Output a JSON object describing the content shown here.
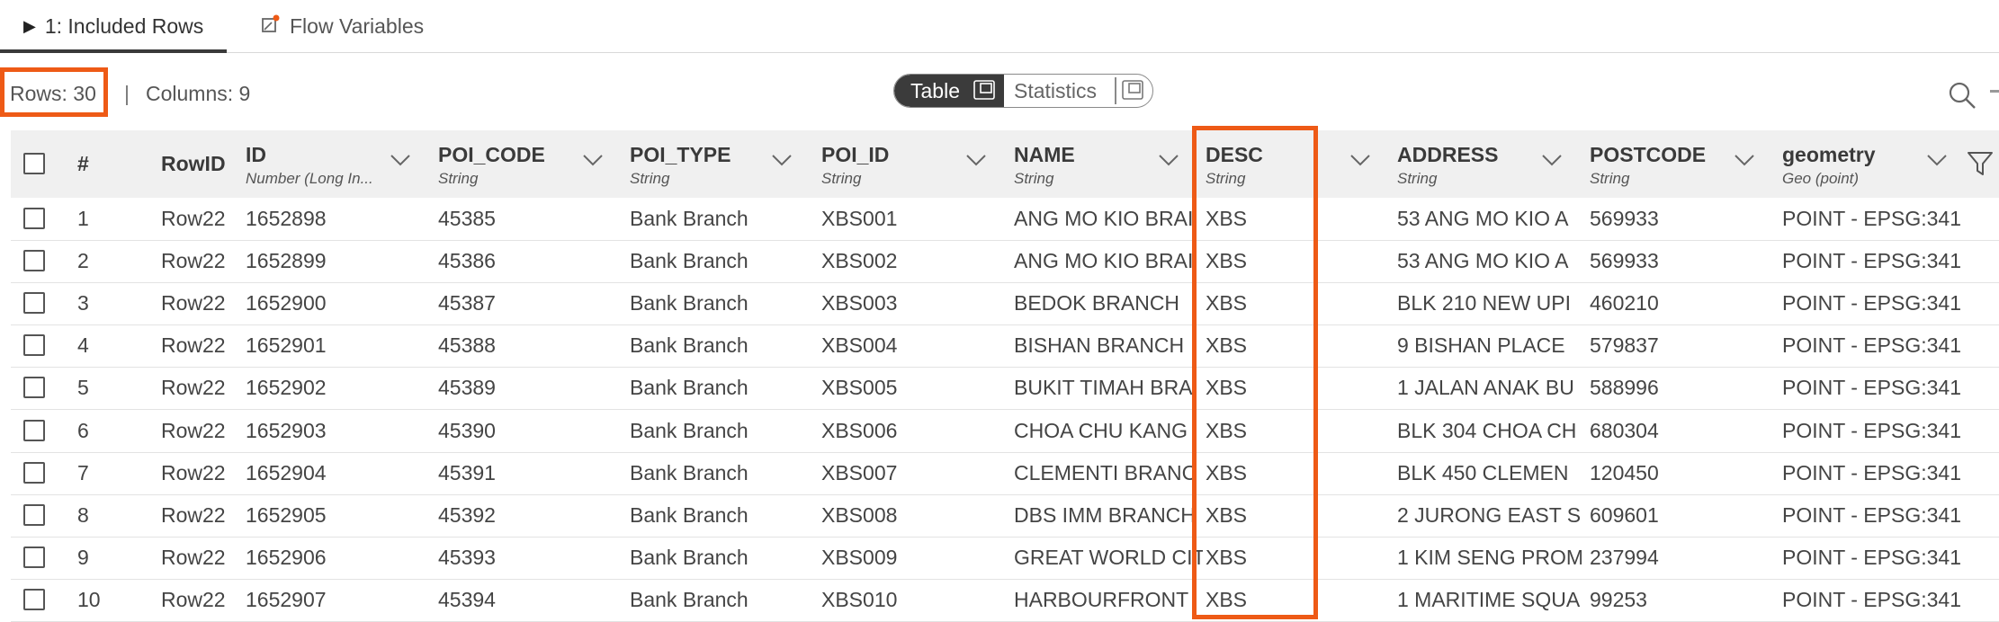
{
  "tabs": [
    {
      "label": "1: Included Rows",
      "active": true
    },
    {
      "label": "Flow Variables",
      "active": false
    }
  ],
  "summary": {
    "rows": "Rows: 30",
    "separator": "|",
    "columns": "Columns: 9"
  },
  "view_toggle": {
    "table": "Table",
    "statistics": "Statistics",
    "selected": "Table"
  },
  "columns": [
    {
      "name": "#",
      "type": ""
    },
    {
      "name": "RowID",
      "type": ""
    },
    {
      "name": "ID",
      "type": "Number (Long In..."
    },
    {
      "name": "POI_CODE",
      "type": "String"
    },
    {
      "name": "POI_TYPE",
      "type": "String"
    },
    {
      "name": "POI_ID",
      "type": "String"
    },
    {
      "name": "NAME",
      "type": "String"
    },
    {
      "name": "DESC",
      "type": "String"
    },
    {
      "name": "ADDRESS",
      "type": "String"
    },
    {
      "name": "POSTCODE",
      "type": "String"
    },
    {
      "name": "geometry",
      "type": "Geo (point)"
    }
  ],
  "rows": [
    {
      "num": "1",
      "rowid": "Row22",
      "id": "1652898",
      "poi_code": "45385",
      "poi_type": "Bank Branch",
      "poi_id": "XBS001",
      "name": "ANG MO KIO BRAI",
      "desc": "XBS",
      "address": "53 ANG MO KIO A",
      "postcode": "569933",
      "geometry": "POINT - EPSG:341"
    },
    {
      "num": "2",
      "rowid": "Row22",
      "id": "1652899",
      "poi_code": "45386",
      "poi_type": "Bank Branch",
      "poi_id": "XBS002",
      "name": "ANG MO KIO BRAI",
      "desc": "XBS",
      "address": "53 ANG MO KIO A",
      "postcode": "569933",
      "geometry": "POINT - EPSG:341"
    },
    {
      "num": "3",
      "rowid": "Row22",
      "id": "1652900",
      "poi_code": "45387",
      "poi_type": "Bank Branch",
      "poi_id": "XBS003",
      "name": "BEDOK BRANCH",
      "desc": "XBS",
      "address": "BLK 210 NEW UPI",
      "postcode": "460210",
      "geometry": "POINT - EPSG:341"
    },
    {
      "num": "4",
      "rowid": "Row22",
      "id": "1652901",
      "poi_code": "45388",
      "poi_type": "Bank Branch",
      "poi_id": "XBS004",
      "name": "BISHAN BRANCH",
      "desc": "XBS",
      "address": "9 BISHAN PLACE",
      "postcode": "579837",
      "geometry": "POINT - EPSG:341"
    },
    {
      "num": "5",
      "rowid": "Row22",
      "id": "1652902",
      "poi_code": "45389",
      "poi_type": "Bank Branch",
      "poi_id": "XBS005",
      "name": "BUKIT TIMAH BRA",
      "desc": "XBS",
      "address": "1 JALAN ANAK BU",
      "postcode": "588996",
      "geometry": "POINT - EPSG:341"
    },
    {
      "num": "6",
      "rowid": "Row22",
      "id": "1652903",
      "poi_code": "45390",
      "poi_type": "Bank Branch",
      "poi_id": "XBS006",
      "name": "CHOA CHU KANG",
      "desc": "XBS",
      "address": "BLK 304 CHOA CH",
      "postcode": "680304",
      "geometry": "POINT - EPSG:341"
    },
    {
      "num": "7",
      "rowid": "Row22",
      "id": "1652904",
      "poi_code": "45391",
      "poi_type": "Bank Branch",
      "poi_id": "XBS007",
      "name": "CLEMENTI BRANC",
      "desc": "XBS",
      "address": "BLK 450 CLEMEN",
      "postcode": "120450",
      "geometry": "POINT - EPSG:341"
    },
    {
      "num": "8",
      "rowid": "Row22",
      "id": "1652905",
      "poi_code": "45392",
      "poi_type": "Bank Branch",
      "poi_id": "XBS008",
      "name": "DBS IMM BRANCH",
      "desc": "XBS",
      "address": "2 JURONG EAST S",
      "postcode": "609601",
      "geometry": "POINT - EPSG:341"
    },
    {
      "num": "9",
      "rowid": "Row22",
      "id": "1652906",
      "poi_code": "45393",
      "poi_type": "Bank Branch",
      "poi_id": "XBS009",
      "name": "GREAT WORLD CIT",
      "desc": "XBS",
      "address": "1 KIM SENG PROM",
      "postcode": "237994",
      "geometry": "POINT - EPSG:341"
    },
    {
      "num": "10",
      "rowid": "Row22",
      "id": "1652907",
      "poi_code": "45394",
      "poi_type": "Bank Branch",
      "poi_id": "XBS010",
      "name": "HARBOURFRONT",
      "desc": "XBS",
      "address": "1 MARITIME SQUA",
      "postcode": "99253",
      "geometry": "POINT - EPSG:341"
    }
  ],
  "icons": {
    "tab_active": "play-triangle-icon",
    "tab_flow": "flow-variables-icon",
    "toggle": "open-in-window-icon",
    "search": "search-icon",
    "sort": "chevron-down-icon",
    "filter": "filter-icon"
  },
  "colors": {
    "highlight": "#ee5a16",
    "toggle_selected": "#3b3b3b",
    "header_bg": "#f0f0f0"
  }
}
